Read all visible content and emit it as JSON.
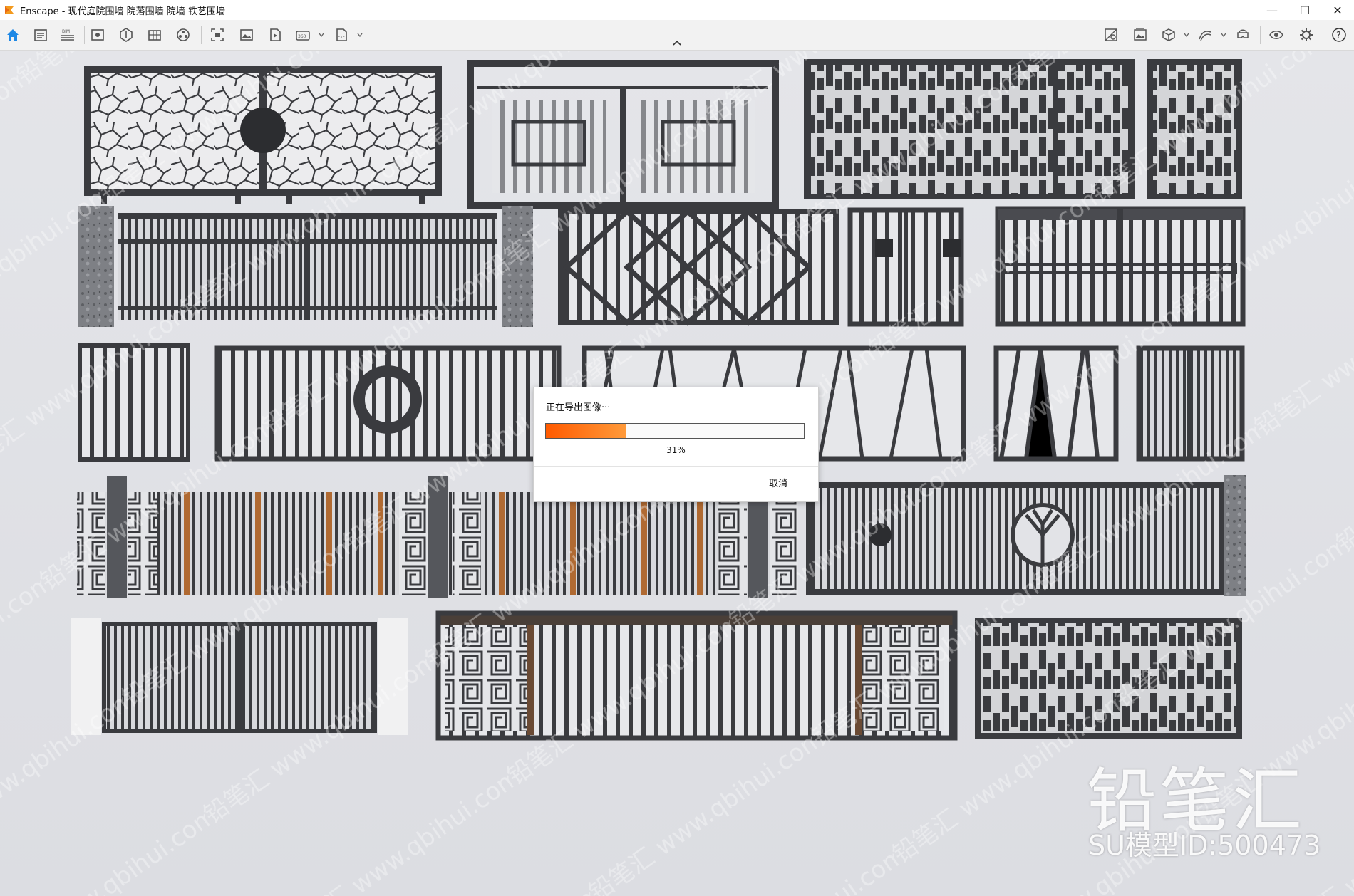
{
  "window": {
    "app_name": "Enscape",
    "title": "Enscape - 现代庭院围墙 院落围墙 院墙 铁艺围墙",
    "controls": {
      "minimize": "—",
      "maximize": "☐",
      "close": "✕"
    }
  },
  "toolbar": {
    "left_icons": [
      "home-icon",
      "project-icon",
      "bim-icon",
      "views-icon",
      "asset-library-icon",
      "materials-icon",
      "site-context-icon",
      "render-settings-icon",
      "screenshot-icon",
      "image-export-icon",
      "video-export-icon",
      "panorama-export-icon",
      "exe-export-icon"
    ],
    "right_icons": [
      "visual-settings-icon",
      "image-gallery-icon",
      "cube-view-icon",
      "sketch-icon",
      "vr-headset-icon",
      "eye-icon",
      "settings-icon",
      "help-icon"
    ],
    "bim_label": "BIM",
    "pano_label": "360",
    "exe_label": "EXE",
    "help_label": "?"
  },
  "export_dialog": {
    "status": "正在导出图像···",
    "progress": 0.31,
    "progress_text": "31%",
    "cancel_label": "取消",
    "accent": "#ff6a10"
  },
  "watermark": {
    "repeated_text": "铅笔汇 www.qbihui.com",
    "brand": "铅笔汇",
    "model_id": "SU模型ID:500473"
  },
  "colors": {
    "metal": "#3a3b3f",
    "wood": "#b06a32",
    "stone": "#8a8c90",
    "background": "#e0e1e5"
  }
}
